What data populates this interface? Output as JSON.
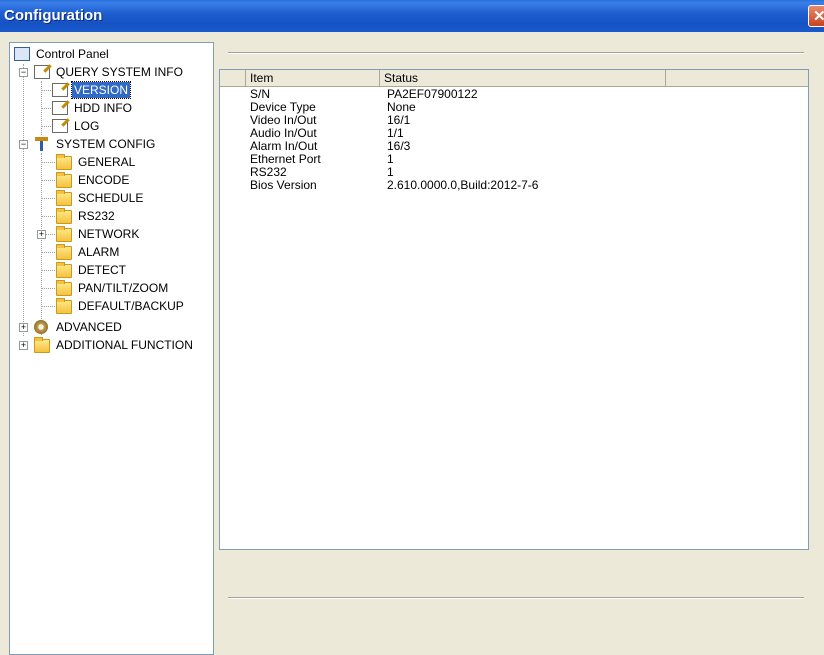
{
  "window": {
    "title": "Configuration",
    "close_glyph": "✕"
  },
  "tree": {
    "root": "Control Panel",
    "query_system_info": "QUERY SYSTEM INFO",
    "version": "VERSION",
    "hdd_info": "HDD INFO",
    "log": "LOG",
    "system_config": "SYSTEM CONFIG",
    "general": "GENERAL",
    "encode": "ENCODE",
    "schedule": "SCHEDULE",
    "rs232": "RS232",
    "network": "NETWORK",
    "alarm": "ALARM",
    "detect": "DETECT",
    "ptz": "PAN/TILT/ZOOM",
    "default_backup": "DEFAULT/BACKUP",
    "advanced": "ADVANCED",
    "additional_function": "ADDITIONAL FUNCTION",
    "selected": "VERSION"
  },
  "table": {
    "headers": {
      "item": "Item",
      "status": "Status"
    },
    "rows": [
      {
        "item": "S/N",
        "status": "PA2EF07900122"
      },
      {
        "item": "Device Type",
        "status": "None"
      },
      {
        "item": "Video In/Out",
        "status": "16/1"
      },
      {
        "item": "Audio In/Out",
        "status": "1/1"
      },
      {
        "item": "Alarm In/Out",
        "status": "16/3"
      },
      {
        "item": "Ethernet Port",
        "status": "1"
      },
      {
        "item": "RS232",
        "status": "1"
      },
      {
        "item": "Bios Version",
        "status": "2.610.0000.0,Build:2012-7-6"
      }
    ]
  },
  "colors": {
    "titlebar": "#1f5fd0",
    "selection": "#316ac5",
    "window_bg": "#ece9d8"
  },
  "icons": {
    "root": "computer-icon",
    "query": "document-pencil-icon",
    "system_config": "tools-icon",
    "folders": "folder-icon",
    "advanced": "gears-icon"
  }
}
